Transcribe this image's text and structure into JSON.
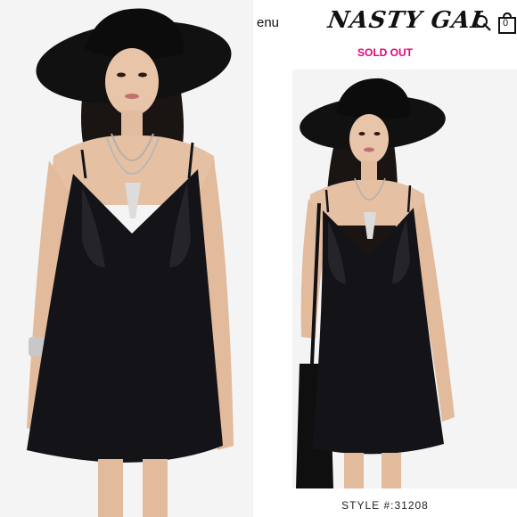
{
  "header": {
    "menu_label": "enu",
    "brand_name": "NASTY GAL",
    "cart_count": "0"
  },
  "product": {
    "status": "SOLD OUT",
    "style_number": "STYLE #:31208"
  },
  "icons": {
    "search": "search-icon",
    "cart": "shopping-bag-icon"
  },
  "colors": {
    "sold_out": "#e6007e",
    "dress": "#141418",
    "hat": "#111111",
    "background": "#f4f4f4"
  }
}
